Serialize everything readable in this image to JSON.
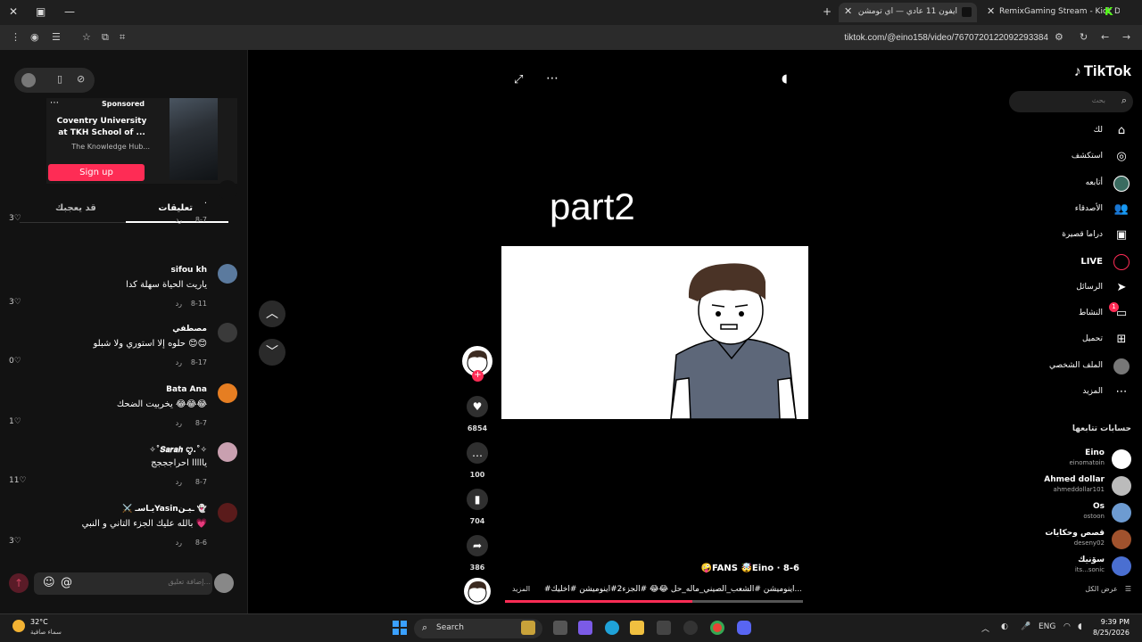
{
  "browser": {
    "tabs": [
      {
        "title": "ايفون 11 عادي — اي تومشن",
        "active": true
      },
      {
        "title": "RemixGaming Stream - Kick Da",
        "active": false
      }
    ],
    "url": "tiktok.com/@eino158/video/7670720122092293384"
  },
  "ad": {
    "sponsored_label": "Sponsored",
    "title": "Coventry University at TKH School of ...",
    "subtitle": "The Knowledge Hub...",
    "cta": "Sign up"
  },
  "comment_tabs": {
    "comments": "تعليقات",
    "for_you": "قد يعجبك"
  },
  "comments": [
    {
      "author": "",
      "text": ".",
      "date": "8-7",
      "reply": "رد",
      "likes": "3",
      "avatar_color": "#121212"
    },
    {
      "author": "sifou kh",
      "text": "ياريت الحياة سهلة كدا",
      "date": "8-11",
      "reply": "رد",
      "likes": "3",
      "avatar_color": "#5b7a9e"
    },
    {
      "author": "مصطفي",
      "text": "حلوه إلا استوري ولا شبلو 😊😊",
      "date": "8-17",
      "reply": "رد",
      "likes": "0",
      "avatar_color": "#3a3a3a"
    },
    {
      "author": "Bata Ana",
      "text": "يخربيت الضحك 😂😂😂",
      "date": "8-7",
      "reply": "رد",
      "likes": "1",
      "avatar_color": "#e67e22"
    },
    {
      "author": "✧˚𝑺𝒂𝒓𝒂𝒉 ꨄ.˚✧",
      "text": "يااااا احراجججج",
      "date": "8-7",
      "reply": "رد",
      "likes": "11",
      "avatar_color": "#c9a0b0"
    },
    {
      "author": "⚔️ يـاسـYasinـيـن 👻",
      "text": "بالله عليك الجزء التاني و النبي 💗",
      "date": "8-6",
      "reply": "رد",
      "likes": "3",
      "avatar_color": "#5a1b1b"
    }
  ],
  "comment_input": {
    "placeholder": "إضافة تعليق..."
  },
  "video": {
    "caption": "part2",
    "author_line": "🤪FANS 🤯Eino · 8-6",
    "description": "#اينوميشن #الشعب_الصيني_ماله_حل 😂😂 #الجزء2#اينوميشن #اخليك...",
    "more_label": "المزيد",
    "progress": 0.63,
    "likes": "6854",
    "comments": "100",
    "saves": "704",
    "shares": "386"
  },
  "sidebar": {
    "logo": "TikTok",
    "search_placeholder": "بحث",
    "nav": [
      {
        "label": "لك",
        "icon": "home-icon",
        "glyph": "⌂"
      },
      {
        "label": "استكشف",
        "icon": "compass-icon",
        "glyph": "◎"
      },
      {
        "label": "أتابعه",
        "icon": "following-icon",
        "glyph": "●"
      },
      {
        "label": "الأصدقاء",
        "icon": "friends-icon",
        "glyph": "👥"
      },
      {
        "label": "دراما قصيرة",
        "icon": "drama-icon",
        "glyph": "▣"
      },
      {
        "label": "LIVE",
        "icon": "live-icon",
        "glyph": "◯"
      },
      {
        "label": "الرسائل",
        "icon": "messages-icon",
        "glyph": "➤"
      },
      {
        "label": "النشاط",
        "icon": "activity-icon",
        "glyph": "▭"
      },
      {
        "label": "تحميل",
        "icon": "upload-icon",
        "glyph": "⊞"
      },
      {
        "label": "الملف الشخصي",
        "icon": "profile-icon",
        "glyph": "●"
      },
      {
        "label": "المزيد",
        "icon": "more-icon",
        "glyph": "⋯"
      }
    ],
    "activity_badge": "1",
    "followed_heading": "حسابات تتابعها",
    "accounts": [
      {
        "name": "Eino",
        "handle": "einomatoin",
        "color": "#ffffff"
      },
      {
        "name": "Ahmed dollar",
        "handle": "ahmeddollar101",
        "color": "#bbbbbb"
      },
      {
        "name": "Os",
        "handle": "ostoon",
        "color": "#6d9bd1"
      },
      {
        "name": "قصص وحكايات",
        "handle": "deseny02",
        "color": "#a0522d"
      },
      {
        "name": "سۆنيك",
        "handle": "its...sonic",
        "color": "#4a6fd1"
      }
    ],
    "see_all": "عرض الكل"
  },
  "taskbar": {
    "temperature": "32°C",
    "condition": "سماء صافية",
    "search_label": "Search",
    "language": "ENG",
    "time": "9:39 PM",
    "date": "8/25/2026"
  },
  "colors": {
    "accent": "#fe2c55",
    "background": "#000000",
    "panel": "#121212"
  }
}
